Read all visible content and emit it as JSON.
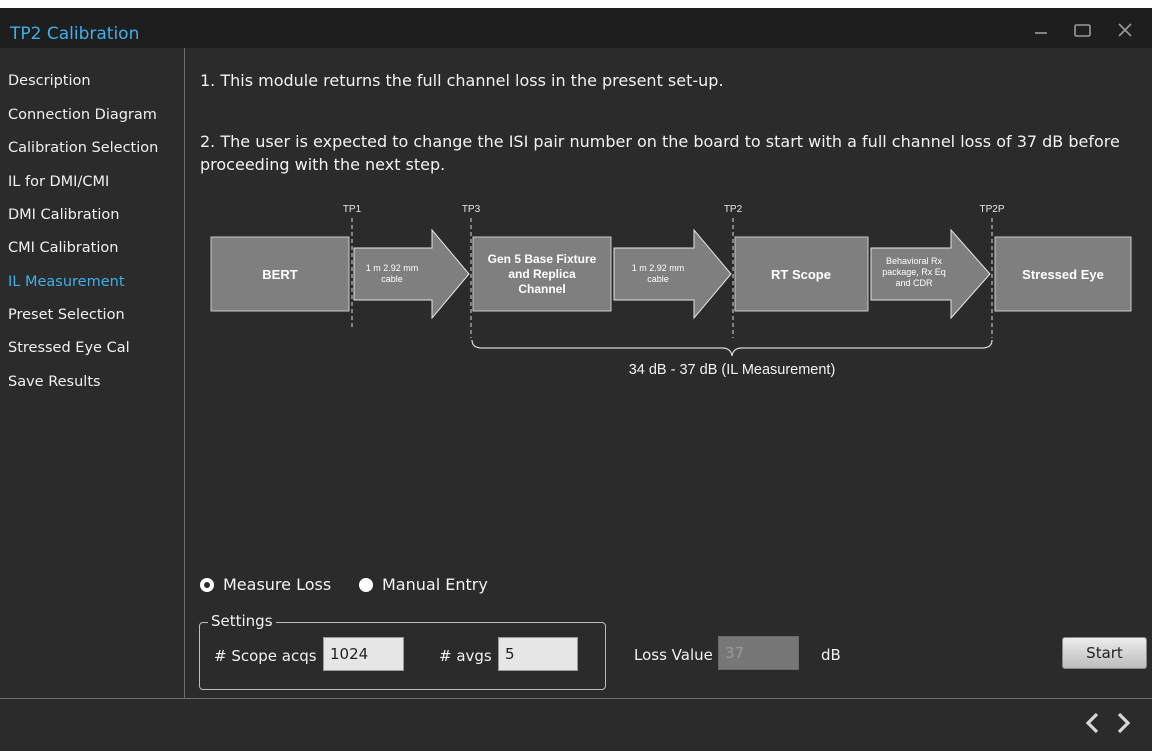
{
  "window": {
    "title": "TP2 Calibration"
  },
  "sidebar": {
    "items": [
      {
        "label": "Description"
      },
      {
        "label": "Connection Diagram"
      },
      {
        "label": "Calibration Selection"
      },
      {
        "label": "IL for DMI/CMI"
      },
      {
        "label": "DMI Calibration"
      },
      {
        "label": "CMI Calibration"
      },
      {
        "label": "IL Measurement",
        "active": true
      },
      {
        "label": "Preset Selection"
      },
      {
        "label": "Stressed Eye Cal"
      },
      {
        "label": "Save Results"
      }
    ]
  },
  "main": {
    "instruction1": "1. This module returns the full channel loss in the present set-up.",
    "instruction2": "2. The user is expected to change the ISI pair number on the board to start with a full channel loss of 37 dB before proceeding with the next step."
  },
  "diagram": {
    "tp_labels": [
      "TP1",
      "TP3",
      "TP2",
      "TP2P"
    ],
    "blocks": {
      "bert": "BERT",
      "fixture": [
        "Gen 5 Base Fixture",
        "and Replica",
        "Channel"
      ],
      "scope": "RT Scope",
      "eye": "Stressed Eye"
    },
    "arrows": {
      "cable1": [
        "1 m 2.92 mm",
        "cable"
      ],
      "cable2": [
        "1 m 2.92 mm",
        "cable"
      ],
      "rx": [
        "Behavioral Rx",
        "package, Rx Eq",
        "and CDR"
      ]
    },
    "range_label": "34 dB - 37 dB (IL Measurement)"
  },
  "mode": {
    "measure_loss": "Measure Loss",
    "manual_entry": "Manual Entry",
    "selected": "measure_loss"
  },
  "settings": {
    "legend": "Settings",
    "scope_acqs_label": "# Scope acqs",
    "scope_acqs_value": "1024",
    "avgs_label": "# avgs",
    "avgs_value": "5"
  },
  "loss": {
    "label": "Loss Value",
    "value": "37",
    "unit": "dB"
  },
  "actions": {
    "start": "Start"
  },
  "colors": {
    "accent": "#3fb0e8",
    "background": "#2b2b2b",
    "titlebar": "#1e1e1e",
    "block": "#7f7f7f"
  }
}
